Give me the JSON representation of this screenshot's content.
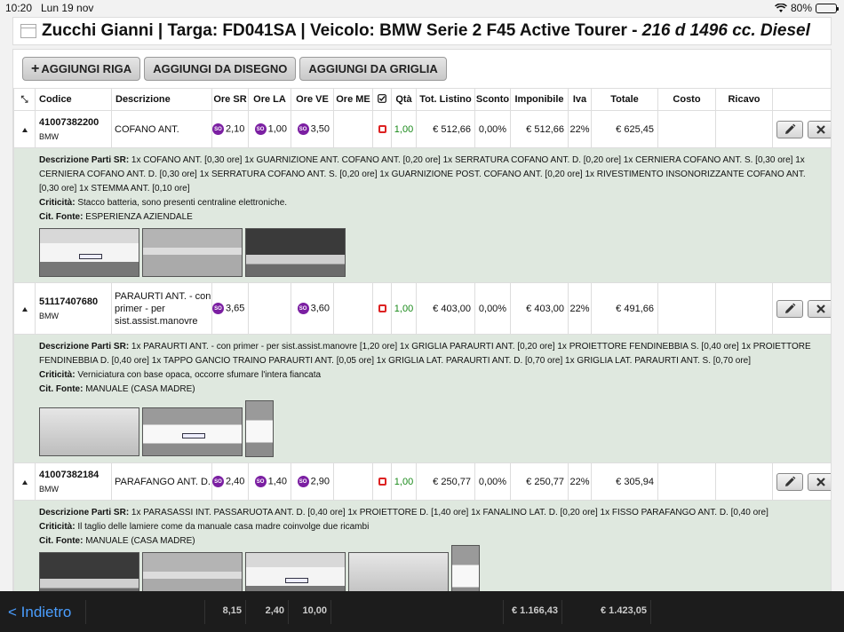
{
  "status": {
    "time": "10:20",
    "date": "Lun 19 nov",
    "battery": "80%",
    "battery_level": 0.8
  },
  "header": {
    "title": "Zucchi Gianni | Targa: FD041SA | Veicolo: BMW Serie 2 F45 Active Tourer - ",
    "title_italic": "216 d 1496 cc. Diesel"
  },
  "toolbar": {
    "add_row": "AGGIUNGI RIGA",
    "add_from_drawing": "AGGIUNGI DA DISEGNO",
    "add_from_grid": "AGGIUNGI DA GRIGLIA"
  },
  "columns": {
    "code": "Codice",
    "description": "Descrizione",
    "ore_sr": "Ore SR",
    "ore_la": "Ore LA",
    "ore_ve": "Ore VE",
    "ore_me": "Ore ME",
    "qty": "Qtà",
    "tot_listino": "Tot. Listino",
    "sconto": "Sconto",
    "imponibile": "Imponibile",
    "iva": "Iva",
    "totale": "Totale",
    "costo": "Costo",
    "ricavo": "Ricavo"
  },
  "badge": "SO",
  "labels": {
    "parts": "Descrizione Parti SR:",
    "criticality": "Criticità:",
    "source": "Cit. Fonte:"
  },
  "rows": [
    {
      "code": "41007382200",
      "brand": "BMW",
      "description": "COFANO ANT.",
      "ore_sr": "2,10",
      "ore_la": "1,00",
      "ore_ve": "3,50",
      "ore_me": "",
      "qty": "1,00",
      "tot_listino": "€ 512,66",
      "sconto": "0,00%",
      "imponibile": "€ 512,66",
      "iva": "22%",
      "totale": "€ 625,45",
      "costo": "",
      "ricavo": "",
      "parts": " 1x COFANO ANT. [0,30 ore] 1x GUARNIZIONE ANT. COFANO ANT. [0,20 ore] 1x SERRATURA COFANO ANT. D. [0,20 ore] 1x CERNIERA COFANO ANT. S. [0,30 ore] 1x CERNIERA COFANO ANT. D. [0,30 ore] 1x SERRATURA COFANO ANT. S. [0,20 ore] 1x GUARNIZIONE POST. COFANO ANT. [0,20 ore] 1x RIVESTIMENTO INSONORIZZANTE COFANO ANT. [0,30 ore] 1x STEMMA ANT. [0,10 ore]",
      "criticality": " Stacco batteria, sono presenti centraline elettroniche.",
      "source": " ESPERIENZA AZIENDALE"
    },
    {
      "code": "51117407680",
      "brand": "BMW",
      "description": "PARAURTI ANT. - con primer - per sist.assist.manovre",
      "ore_sr": "3,65",
      "ore_la": "",
      "ore_ve": "3,60",
      "ore_me": "",
      "qty": "1,00",
      "tot_listino": "€ 403,00",
      "sconto": "0,00%",
      "imponibile": "€ 403,00",
      "iva": "22%",
      "totale": "€ 491,66",
      "costo": "",
      "ricavo": "",
      "parts": " 1x PARAURTI ANT. - con primer - per sist.assist.manovre [1,20 ore] 1x GRIGLIA PARAURTI ANT. [0,20 ore] 1x PROIETTORE FENDINEBBIA S. [0,40 ore] 1x PROIETTORE FENDINEBBIA D. [0,40 ore] 1x TAPPO GANCIO TRAINO PARAURTI ANT. [0,05 ore] 1x GRIGLIA LAT. PARAURTI ANT. D. [0,70 ore] 1x GRIGLIA LAT. PARAURTI ANT. S. [0,70 ore]",
      "criticality": " Verniciatura con base opaca, occorre sfumare l'intera fiancata",
      "source": " MANUALE (CASA MADRE)"
    },
    {
      "code": "41007382184",
      "brand": "BMW",
      "description": "PARAFANGO ANT. D.",
      "ore_sr": "2,40",
      "ore_la": "1,40",
      "ore_ve": "2,90",
      "ore_me": "",
      "qty": "1,00",
      "tot_listino": "€ 250,77",
      "sconto": "0,00%",
      "imponibile": "€ 250,77",
      "iva": "22%",
      "totale": "€ 305,94",
      "costo": "",
      "ricavo": "",
      "parts": " 1x PARASASSI INT. PASSARUOTA ANT. D. [0,40 ore] 1x PROIETTORE D. [1,40 ore] 1x FANALINO LAT. D. [0,20 ore] 1x FISSO PARAFANGO ANT. D. [0,40 ore]",
      "criticality": " Il taglio delle lamiere come da manuale casa madre coinvolge due ricambi",
      "source": " MANUALE (CASA MADRE)"
    }
  ],
  "footer": {
    "back": "< Indietro",
    "ore_sr": "8,15",
    "ore_la": "2,40",
    "ore_ve": "10,00",
    "imponibile": "€ 1.166,43",
    "totale": "€ 1.423,05"
  }
}
